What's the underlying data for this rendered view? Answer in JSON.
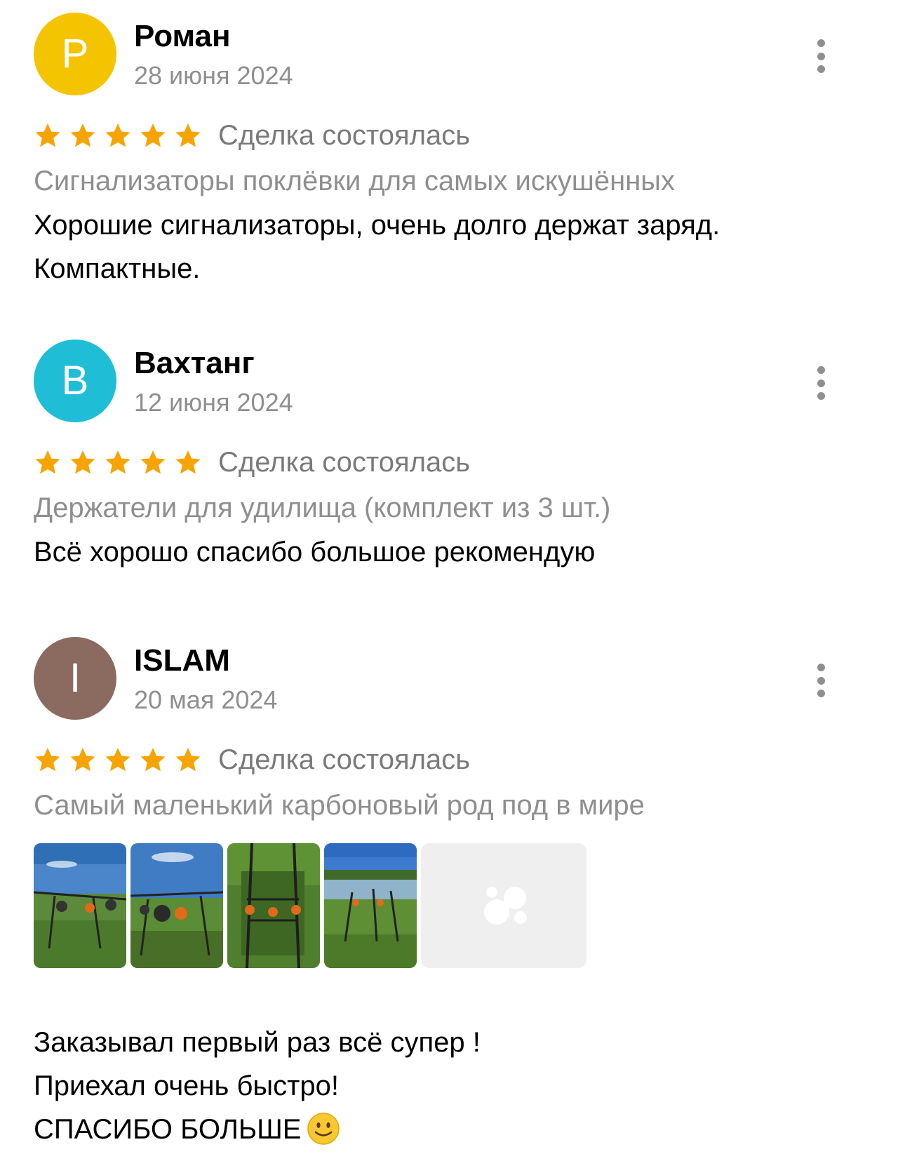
{
  "colors": {
    "star": "#f7a400",
    "avatar_roman": "#f5c400",
    "avatar_vakhtang": "#1fbed6",
    "avatar_islam": "#8b6b5f",
    "secondary_text": "#8f8f8f"
  },
  "reviews": [
    {
      "avatar_letter": "Р",
      "name": "Роман",
      "date": "28 июня 2024",
      "rating": 5,
      "deal_status": "Сделка состоялась",
      "product": "Сигнализаторы поклёвки для самых искушённых",
      "text": "Хорошие сигнализаторы, очень долго держат заряд.\nКомпактные."
    },
    {
      "avatar_letter": "В",
      "name": "Вахтанг",
      "date": "12 июня 2024",
      "rating": 5,
      "deal_status": "Сделка состоялась",
      "product": "Держатели для удилища (комплект из 3 шт.)",
      "text": "Всё хорошо спасибо большое рекомендую"
    },
    {
      "avatar_letter": "I",
      "name": "ISLAM",
      "date": "20 мая 2024",
      "rating": 5,
      "deal_status": "Сделка состоялась",
      "product": "Самый маленький карбоновый род под в мире",
      "text": "Заказывал первый раз всё супер !\nПриехал очень быстро!\nСПАСИБО БОЛЬШЕ",
      "photos_count_visible": 4,
      "emoji": "smiling-face-emoji"
    }
  ]
}
